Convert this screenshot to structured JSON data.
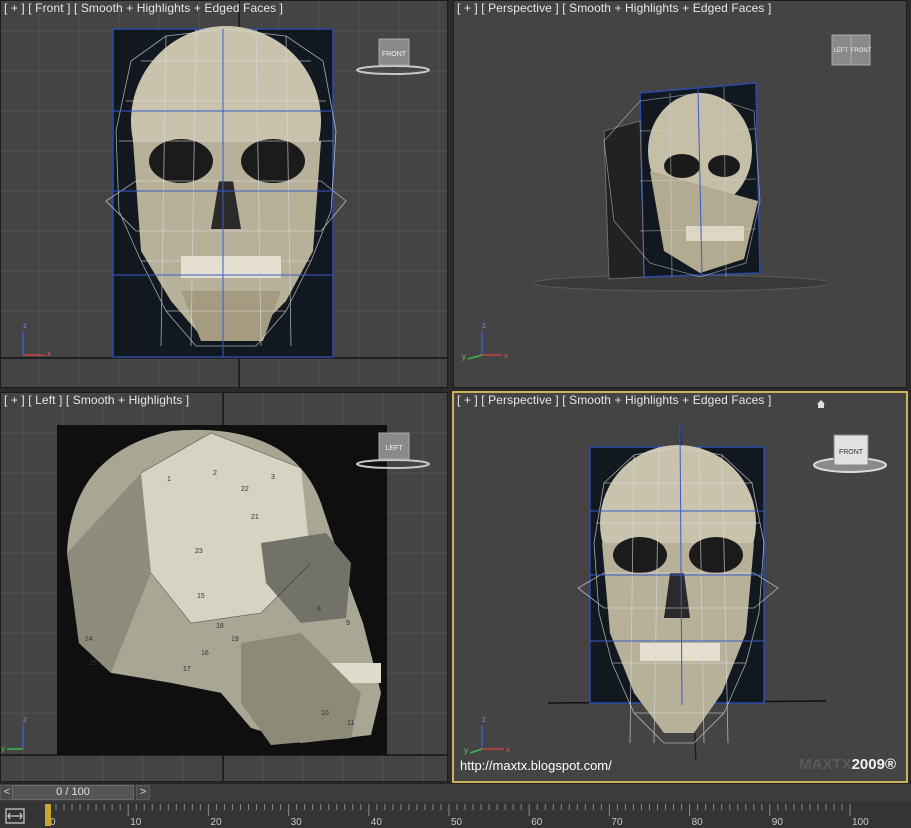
{
  "viewports": {
    "front": {
      "label": "[ + ] [ Front ] [ Smooth + Highlights + Edged Faces ]",
      "cube_label": "FRONT"
    },
    "persp_top": {
      "label": "[ + ] [ Perspective ] [ Smooth + Highlights + Edged Faces ]",
      "cube_label_1": "LEFT",
      "cube_label_2": "FRONT"
    },
    "left": {
      "label": "[ + ] [ Left ] [ Smooth + Highlights ]",
      "cube_label": "LEFT",
      "mesh_numbers": [
        "1",
        "2",
        "3",
        "22",
        "21",
        "23",
        "15",
        "16",
        "17",
        "18",
        "19",
        "24",
        "25",
        "10",
        "11",
        "8",
        "9"
      ]
    },
    "persp_bottom": {
      "label": "[ + ] [ Perspective ] [ Smooth + Highlights + Edged Faces ]",
      "cube_label": "FRONT",
      "url_text": "http://maxtx.blogspot.com/",
      "brand_main": "MAXTX",
      "brand_year": "2009®"
    }
  },
  "axes": {
    "x": "x",
    "y": "y",
    "z": "z"
  },
  "timeline": {
    "frame_readout": "0 / 100",
    "prev_label": "<",
    "next_label": ">",
    "ticks": [
      "0",
      "10",
      "20",
      "30",
      "40",
      "50",
      "60",
      "70",
      "80",
      "90",
      "100"
    ]
  },
  "colors": {
    "active_border": "#c9b25a",
    "viewport_bg": "#444444",
    "grid": "#525252",
    "blue_line": "#3c5ac8",
    "thumb": "#c8a636"
  }
}
